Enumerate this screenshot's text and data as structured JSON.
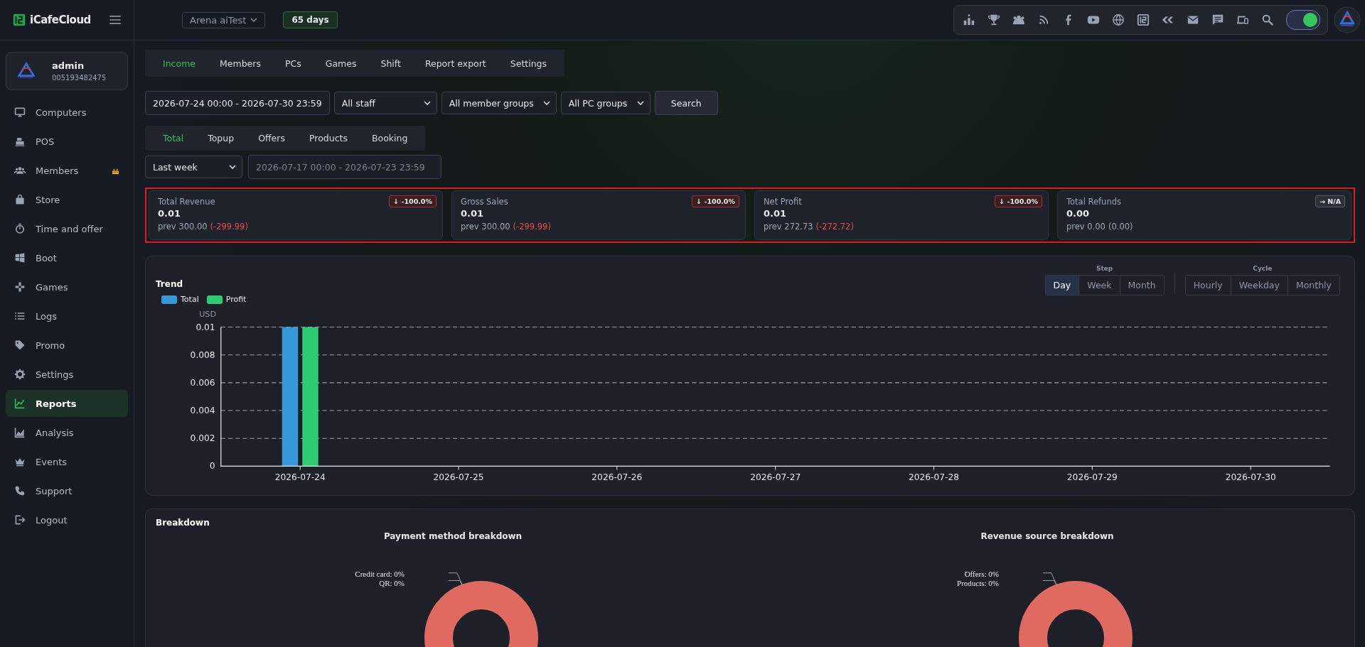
{
  "brand": {
    "name": "iCafeCloud"
  },
  "topbar": {
    "center": "Arena aiTest",
    "days": "65 days",
    "toggle": {
      "on": true
    }
  },
  "profile": {
    "name": "admin",
    "id": "005193482475"
  },
  "sidebar": {
    "items": [
      {
        "label": "Computers",
        "selected": false,
        "badge": false
      },
      {
        "label": "POS",
        "selected": false,
        "badge": false
      },
      {
        "label": "Members",
        "selected": false,
        "badge": true
      },
      {
        "label": "Store",
        "selected": false,
        "badge": false
      },
      {
        "label": "Time and offer",
        "selected": false,
        "badge": false
      },
      {
        "label": "Boot",
        "selected": false,
        "badge": false
      },
      {
        "label": "Games",
        "selected": false,
        "badge": false
      },
      {
        "label": "Logs",
        "selected": false,
        "badge": false
      },
      {
        "label": "Promo",
        "selected": false,
        "badge": false
      },
      {
        "label": "Settings",
        "selected": false,
        "badge": false
      },
      {
        "label": "Reports",
        "selected": true,
        "badge": false
      },
      {
        "label": "Analysis",
        "selected": false,
        "badge": false
      },
      {
        "label": "Events",
        "selected": false,
        "badge": false
      },
      {
        "label": "Support",
        "selected": false,
        "badge": false
      },
      {
        "label": "Logout",
        "selected": false,
        "badge": false
      }
    ]
  },
  "tabs": [
    {
      "label": "Income",
      "selected": true
    },
    {
      "label": "Members",
      "selected": false
    },
    {
      "label": "PCs",
      "selected": false
    },
    {
      "label": "Games",
      "selected": false
    },
    {
      "label": "Shift",
      "selected": false
    },
    {
      "label": "Report export",
      "selected": false
    },
    {
      "label": "Settings",
      "selected": false
    }
  ],
  "filters": {
    "date_range": "2026-07-24 00:00 - 2026-07-30 23:59",
    "staff": "All staff",
    "member_groups": "All member groups",
    "pc_groups": "All PC groups",
    "search_button": "Search"
  },
  "subtabs": [
    {
      "label": "Total",
      "selected": true
    },
    {
      "label": "Topup",
      "selected": false
    },
    {
      "label": "Offers",
      "selected": false
    },
    {
      "label": "Products",
      "selected": false
    },
    {
      "label": "Booking",
      "selected": false
    }
  ],
  "compare": {
    "period": "Last week",
    "range": "2026-07-17 00:00 - 2026-07-23 23:59"
  },
  "cards": [
    {
      "title": "Total Revenue",
      "value": "0.01",
      "badge": "↓ -100.0%",
      "kind": "down",
      "prev": "prev 300.00",
      "delta": "(-299.99)"
    },
    {
      "title": "Gross Sales",
      "value": "0.01",
      "badge": "↓ -100.0%",
      "kind": "down",
      "prev": "prev 300.00",
      "delta": "(-299.99)"
    },
    {
      "title": "Net Profit",
      "value": "0.01",
      "badge": "↓ -100.0%",
      "kind": "down",
      "prev": "prev 272.73",
      "delta": "(-272.72)"
    },
    {
      "title": "Total Refunds",
      "value": "0.00",
      "badge": "→ N/A",
      "kind": "flat",
      "prev": "prev 0.00",
      "delta": "(0.00)"
    }
  ],
  "trend": {
    "title": "Trend",
    "step_label": "Step",
    "steps": [
      {
        "label": "Day",
        "selected": true
      },
      {
        "label": "Week",
        "selected": false
      },
      {
        "label": "Month",
        "selected": false
      }
    ],
    "cycle_label": "Cycle",
    "cycles": [
      {
        "label": "Hourly",
        "selected": false
      },
      {
        "label": "Weekday",
        "selected": false
      },
      {
        "label": "Monthly",
        "selected": false
      }
    ],
    "chart_data": {
      "type": "bar",
      "ylabel": "USD",
      "grid": true,
      "categories": [
        "2026-07-24",
        "2026-07-25",
        "2026-07-26",
        "2026-07-27",
        "2026-07-28",
        "2026-07-29",
        "2026-07-30"
      ],
      "series": [
        {
          "name": "Total",
          "color": "#3498db",
          "values": [
            0.01,
            0,
            0,
            0,
            0,
            0,
            0
          ]
        },
        {
          "name": "Profit",
          "color": "#2ecc71",
          "values": [
            0.01,
            0,
            0,
            0,
            0,
            0,
            0
          ]
        }
      ],
      "ylim": [
        0,
        0.01
      ],
      "yticks": [
        0,
        0.002,
        0.004,
        0.006,
        0.008,
        0.01
      ]
    }
  },
  "breakdown": {
    "title": "Breakdown",
    "panels": [
      {
        "title": "Payment method breakdown",
        "labels": [
          "Credit card: 0%",
          "QR: 0%"
        ]
      },
      {
        "title": "Revenue source breakdown",
        "labels": [
          "Offers: 0%",
          "Products: 0%"
        ]
      }
    ]
  }
}
